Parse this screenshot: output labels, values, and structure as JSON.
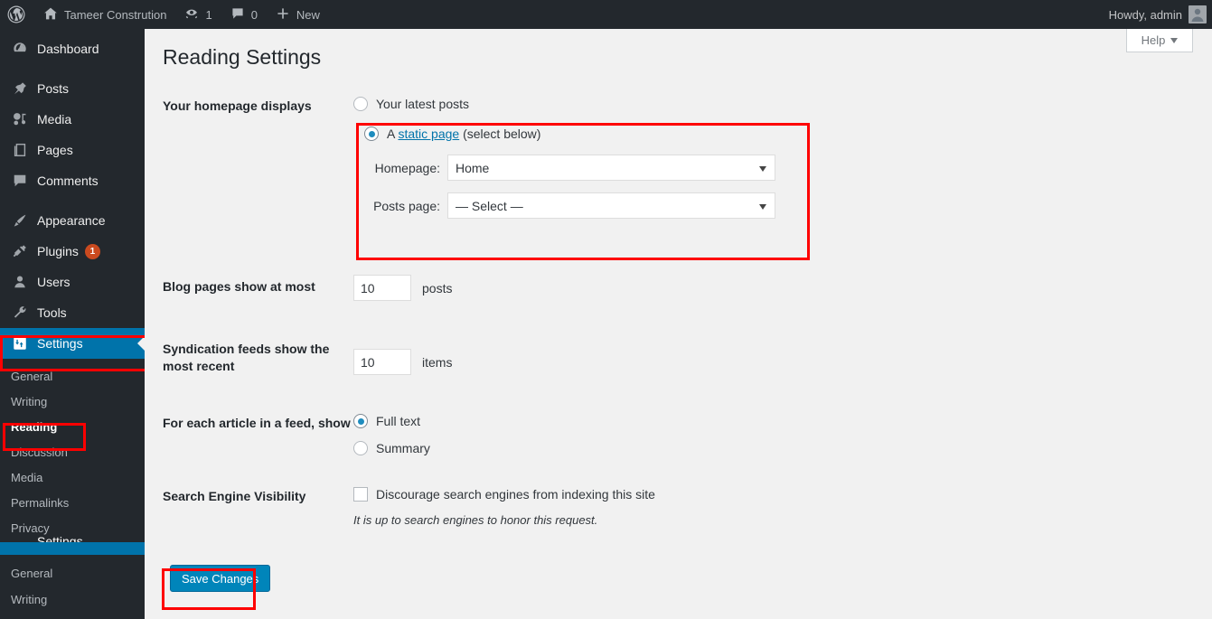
{
  "adminbar": {
    "logo_icon": "wordpress-logo-icon",
    "site_name": "Tameer Constrution",
    "home_icon": "home-icon",
    "updates_icon": "updates-icon",
    "updates_count": "1",
    "comments_icon": "comment-bubble-icon",
    "comments_count": "0",
    "new_icon": "plus-icon",
    "new_label": "New",
    "howdy": "Howdy, admin",
    "avatar_icon": "user-avatar-icon"
  },
  "sidebar": {
    "items": [
      {
        "label": "Dashboard",
        "icon": "dashboard-icon",
        "badge": ""
      },
      {
        "label": "Posts",
        "icon": "pin-icon",
        "badge": ""
      },
      {
        "label": "Media",
        "icon": "media-icon",
        "badge": ""
      },
      {
        "label": "Pages",
        "icon": "page-icon",
        "badge": ""
      },
      {
        "label": "Comments",
        "icon": "comment-bubble-icon",
        "badge": ""
      },
      {
        "label": "Appearance",
        "icon": "paintbrush-icon",
        "badge": ""
      },
      {
        "label": "Plugins",
        "icon": "plug-icon",
        "badge": "1"
      },
      {
        "label": "Users",
        "icon": "user-icon",
        "badge": ""
      },
      {
        "label": "Tools",
        "icon": "wrench-icon",
        "badge": ""
      },
      {
        "label": "Settings",
        "icon": "settings-sliders-icon",
        "badge": ""
      }
    ],
    "submenu": [
      {
        "label": "General"
      },
      {
        "label": "Writing"
      },
      {
        "label": "Reading"
      },
      {
        "label": "Discussion"
      },
      {
        "label": "Media"
      },
      {
        "label": "Permalinks"
      },
      {
        "label": "Privacy"
      }
    ],
    "ghost_label": "Settings",
    "submenu_tail": [
      {
        "label": "General"
      },
      {
        "label": "Writing"
      }
    ],
    "active_item": "Settings",
    "active_submenu": "Reading"
  },
  "help_tab": {
    "label": "Help"
  },
  "page": {
    "title": "Reading Settings"
  },
  "form": {
    "homepage_displays": {
      "label": "Your homepage displays",
      "latest_posts_label": "Your latest posts",
      "latest_posts_checked": false,
      "static_page_prefix": "A ",
      "static_page_link": "static page",
      "static_page_suffix": " (select below)",
      "static_page_checked": true,
      "homepage_label": "Homepage:",
      "homepage_value": "Home",
      "posts_page_label": "Posts page:",
      "posts_page_value": "— Select —"
    },
    "blog_pages": {
      "label": "Blog pages show at most",
      "value": "10",
      "unit": "posts"
    },
    "syndication": {
      "label": "Syndication feeds show the most recent",
      "value": "10",
      "unit": "items"
    },
    "feed_show": {
      "label": "For each article in a feed, show",
      "full_text_label": "Full text",
      "full_text_checked": true,
      "summary_label": "Summary",
      "summary_checked": false
    },
    "search_visibility": {
      "label": "Search Engine Visibility",
      "checkbox_label": "Discourage search engines from indexing this site",
      "checked": false,
      "description": "It is up to search engines to honor this request."
    },
    "save_label": "Save Changes"
  },
  "colors": {
    "admin_dark": "#23282d",
    "accent_blue": "#0073aa",
    "button_blue": "#0085ba",
    "link_blue": "#0073aa",
    "badge_orange": "#ca4a1f",
    "highlight_red": "#fe0000",
    "page_bg": "#f1f1f1"
  }
}
